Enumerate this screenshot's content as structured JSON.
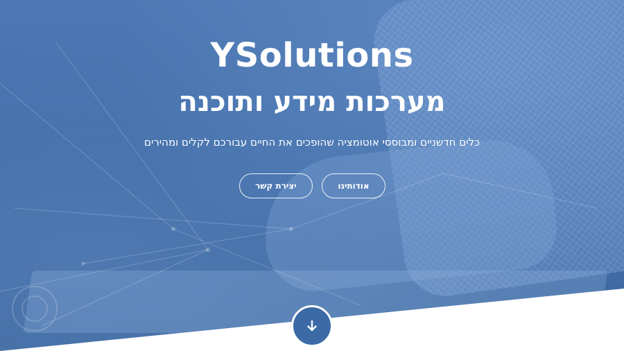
{
  "hero": {
    "brand": "YSolutions",
    "subtitle": "מערכות מידע ותוכנה",
    "tagline": "כלים חדשניים ומבוססי אוטומציה שהופכים את החיים עבורכם לקלים ומהירים"
  },
  "buttons": {
    "about_label": "אודותינו",
    "contact_label": "יצירת קשר"
  },
  "scroll_down": {
    "icon": "arrow-down-icon"
  },
  "colors": {
    "background": "#416ea9",
    "text": "#ffffff",
    "scroll_button": "#3c6aa6",
    "bottom_band": "#ffffff"
  }
}
